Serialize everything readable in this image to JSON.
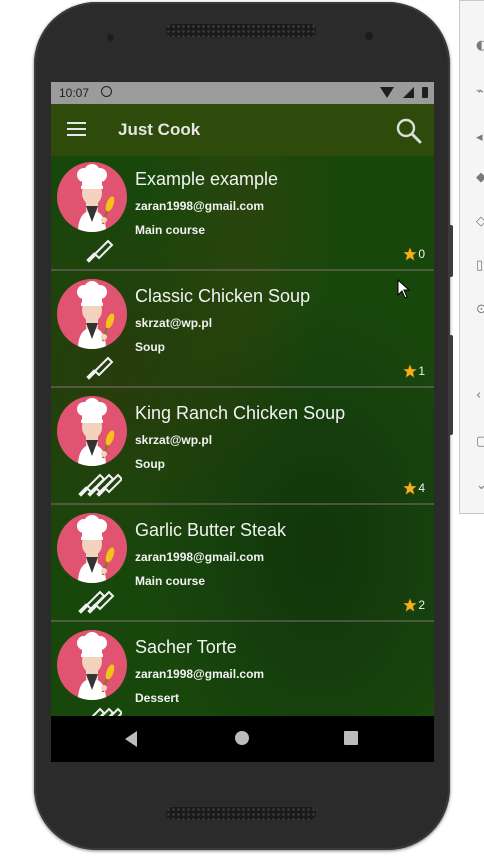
{
  "status_bar": {
    "time": "10:07"
  },
  "app_bar": {
    "title": "Just Cook",
    "search_icon": "search-icon",
    "menu_icon": "menu-icon"
  },
  "colors": {
    "app_bar": "#2e4b0c",
    "list_background": "#18470c",
    "avatar": "#e05371",
    "star": "#f5b11d",
    "text": "#f2f2f2"
  },
  "recipes": [
    {
      "title": "Example example",
      "author": "zaran1998@gmail.com",
      "category": "Main course",
      "rating": "0",
      "difficulty_icon": "knife-icon",
      "difficulty_level": 1
    },
    {
      "title": "Classic Chicken Soup",
      "author": "skrzat@wp.pl",
      "category": "Soup",
      "rating": "1",
      "difficulty_icon": "knife-icon",
      "difficulty_level": 1
    },
    {
      "title": "King Ranch Chicken Soup",
      "author": "skrzat@wp.pl",
      "category": "Soup",
      "rating": "4",
      "difficulty_icon": "knives-icon",
      "difficulty_level": 3
    },
    {
      "title": "Garlic Butter Steak",
      "author": "zaran1998@gmail.com",
      "category": "Main course",
      "rating": "2",
      "difficulty_icon": "knives-icon",
      "difficulty_level": 2
    },
    {
      "title": "Sacher Torte",
      "author": "zaran1998@gmail.com",
      "category": "Dessert",
      "rating": "",
      "difficulty_icon": "knives-icon",
      "difficulty_level": 3
    }
  ]
}
